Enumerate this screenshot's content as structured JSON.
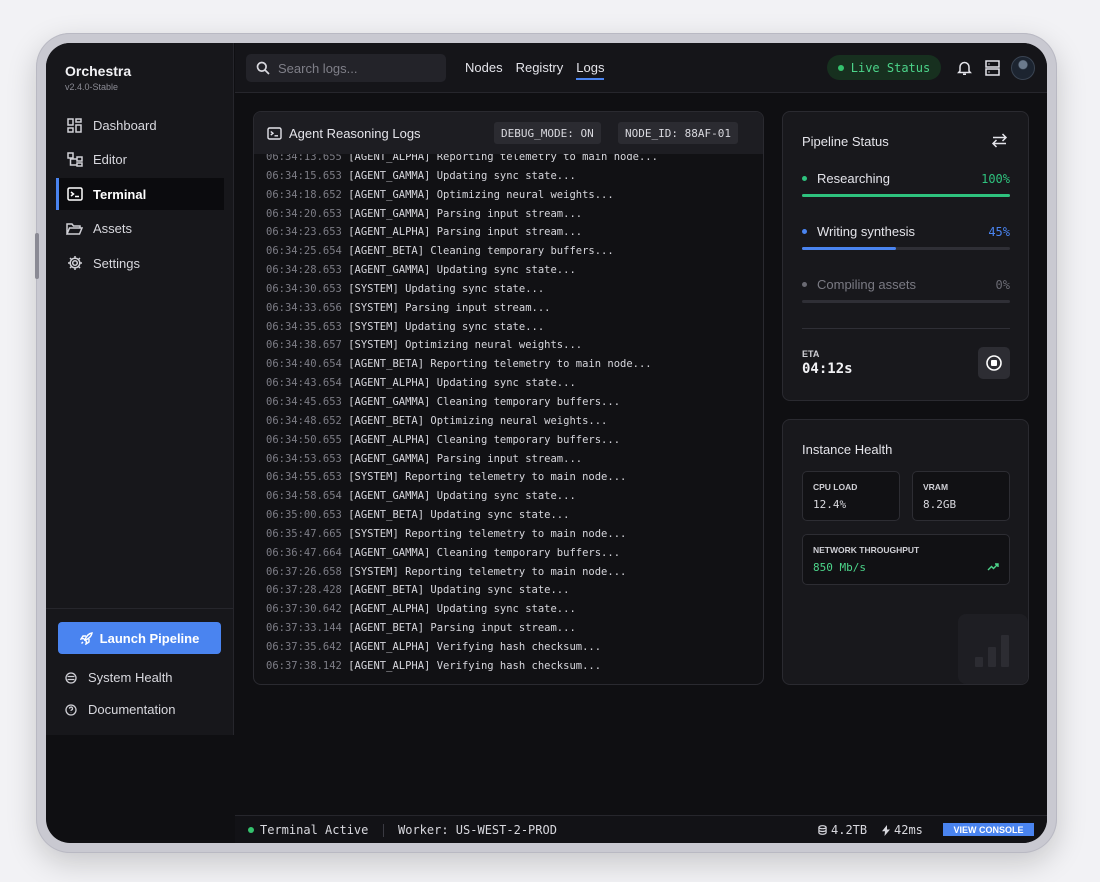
{
  "app": {
    "name": "Orchestra",
    "version": "v2.4.0-Stable"
  },
  "sidebar": {
    "items": [
      {
        "label": "Dashboard",
        "icon": "dashboard-icon"
      },
      {
        "label": "Editor",
        "icon": "editor-icon"
      },
      {
        "label": "Terminal",
        "icon": "terminal-icon",
        "active": true
      },
      {
        "label": "Assets",
        "icon": "folder-icon"
      },
      {
        "label": "Settings",
        "icon": "gear-icon"
      }
    ],
    "launch_label": "Launch Pipeline",
    "system_health_label": "System Health",
    "documentation_label": "Documentation"
  },
  "topbar": {
    "search_placeholder": "Search logs...",
    "tabs": [
      {
        "label": "Nodes"
      },
      {
        "label": "Registry"
      },
      {
        "label": "Logs",
        "active": true
      }
    ],
    "live_status": "Live Status"
  },
  "logs": {
    "title": "Agent Reasoning Logs",
    "debug_badge": "DEBUG_MODE: ON",
    "node_badge": "NODE_ID: 88AF-01",
    "lines": [
      {
        "ts": "06:34:13.655",
        "msg": "[AGENT_ALPHA] Reporting telemetry to main node..."
      },
      {
        "ts": "06:34:15.653",
        "msg": "[AGENT_GAMMA] Updating sync state..."
      },
      {
        "ts": "06:34:18.652",
        "msg": "[AGENT_GAMMA] Optimizing neural weights..."
      },
      {
        "ts": "06:34:20.653",
        "msg": "[AGENT_GAMMA] Parsing input stream..."
      },
      {
        "ts": "06:34:23.653",
        "msg": "[AGENT_ALPHA] Parsing input stream..."
      },
      {
        "ts": "06:34:25.654",
        "msg": "[AGENT_BETA] Cleaning temporary buffers..."
      },
      {
        "ts": "06:34:28.653",
        "msg": "[AGENT_GAMMA] Updating sync state..."
      },
      {
        "ts": "06:34:30.653",
        "msg": "[SYSTEM] Updating sync state..."
      },
      {
        "ts": "06:34:33.656",
        "msg": "[SYSTEM] Parsing input stream..."
      },
      {
        "ts": "06:34:35.653",
        "msg": "[SYSTEM] Updating sync state..."
      },
      {
        "ts": "06:34:38.657",
        "msg": "[SYSTEM] Optimizing neural weights..."
      },
      {
        "ts": "06:34:40.654",
        "msg": "[AGENT_BETA] Reporting telemetry to main node..."
      },
      {
        "ts": "06:34:43.654",
        "msg": "[AGENT_ALPHA] Updating sync state..."
      },
      {
        "ts": "06:34:45.653",
        "msg": "[AGENT_GAMMA] Cleaning temporary buffers..."
      },
      {
        "ts": "06:34:48.652",
        "msg": "[AGENT_BETA] Optimizing neural weights..."
      },
      {
        "ts": "06:34:50.655",
        "msg": "[AGENT_ALPHA] Cleaning temporary buffers..."
      },
      {
        "ts": "06:34:53.653",
        "msg": "[AGENT_GAMMA] Parsing input stream..."
      },
      {
        "ts": "06:34:55.653",
        "msg": "[SYSTEM] Reporting telemetry to main node..."
      },
      {
        "ts": "06:34:58.654",
        "msg": "[AGENT_GAMMA] Updating sync state..."
      },
      {
        "ts": "06:35:00.653",
        "msg": "[AGENT_BETA] Updating sync state..."
      },
      {
        "ts": "06:35:47.665",
        "msg": "[SYSTEM] Reporting telemetry to main node..."
      },
      {
        "ts": "06:36:47.664",
        "msg": "[AGENT_GAMMA] Cleaning temporary buffers..."
      },
      {
        "ts": "06:37:26.658",
        "msg": "[SYSTEM] Reporting telemetry to main node..."
      },
      {
        "ts": "06:37:28.428",
        "msg": "[AGENT_BETA] Updating sync state..."
      },
      {
        "ts": "06:37:30.642",
        "msg": "[AGENT_ALPHA] Updating sync state..."
      },
      {
        "ts": "06:37:33.144",
        "msg": "[AGENT_BETA] Parsing input stream..."
      },
      {
        "ts": "06:37:35.642",
        "msg": "[AGENT_ALPHA] Verifying hash checksum..."
      },
      {
        "ts": "06:37:38.142",
        "msg": "[AGENT_ALPHA] Verifying hash checksum..."
      }
    ]
  },
  "pipeline": {
    "title": "Pipeline Status",
    "stages": [
      {
        "label": "Researching",
        "pct_label": "100%",
        "progress": 1.0,
        "color": "#2ec27e",
        "dim": false
      },
      {
        "label": "Writing synthesis",
        "pct_label": "45%",
        "progress": 0.45,
        "color": "#4a84f0",
        "dim": false
      },
      {
        "label": "Compiling assets",
        "pct_label": "0%",
        "progress": 0.0,
        "color": "#6a6a73",
        "dim": true
      }
    ],
    "eta_label": "ETA",
    "eta_value": "04:12s"
  },
  "health": {
    "title": "Instance Health",
    "cpu_label": "CPU LOAD",
    "cpu_value": "12.4%",
    "vram_label": "VRAM",
    "vram_value": "8.2GB",
    "network_label": "NETWORK THROUGHPUT",
    "network_value": "850 Mb/s"
  },
  "footer": {
    "terminal_status": "Terminal Active",
    "worker": "Worker: US-WEST-2-PROD",
    "storage": "4.2TB",
    "latency": "42ms",
    "view_console": "VIEW CONSOLE"
  },
  "colors": {
    "accent": "#4a84f0",
    "success": "#2ec27e",
    "background": "#0f0f12"
  }
}
